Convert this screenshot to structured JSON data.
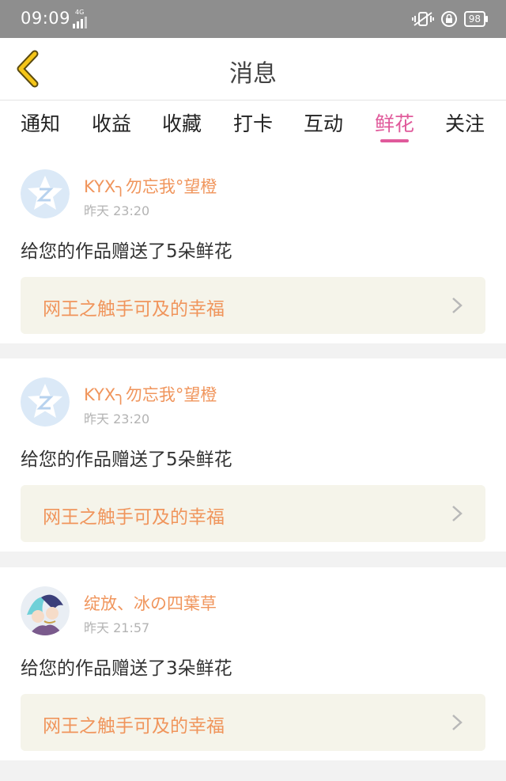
{
  "status_bar": {
    "time": "09:09",
    "network_label": "4G",
    "battery": "98"
  },
  "header": {
    "title": "消息"
  },
  "tabs": [
    {
      "label": "通知",
      "active": false
    },
    {
      "label": "收益",
      "active": false
    },
    {
      "label": "收藏",
      "active": false
    },
    {
      "label": "打卡",
      "active": false
    },
    {
      "label": "互动",
      "active": false
    },
    {
      "label": "鲜花",
      "active": true
    },
    {
      "label": "关注",
      "active": false
    }
  ],
  "messages": [
    {
      "username": "KYX╮勿忘我°望橙",
      "time": "昨天 23:20",
      "text": "给您的作品赠送了5朵鲜花",
      "link_title": "网王之触手可及的幸福",
      "avatar": "default-star-avatar"
    },
    {
      "username": "KYX╮勿忘我°望橙",
      "time": "昨天 23:20",
      "text": "给您的作品赠送了5朵鲜花",
      "link_title": "网王之触手可及的幸福",
      "avatar": "default-star-avatar"
    },
    {
      "username": "绽放、冰の四葉草",
      "time": "昨天 21:57",
      "text": "给您的作品赠送了3朵鲜花",
      "link_title": "网王之触手可及的幸福",
      "avatar": "anime-character-avatar"
    }
  ],
  "colors": {
    "accent_pink": "#e05a9b",
    "username_orange": "#f0955c",
    "back_yellow": "#f5c518",
    "link_bg": "#f5f4ea"
  }
}
